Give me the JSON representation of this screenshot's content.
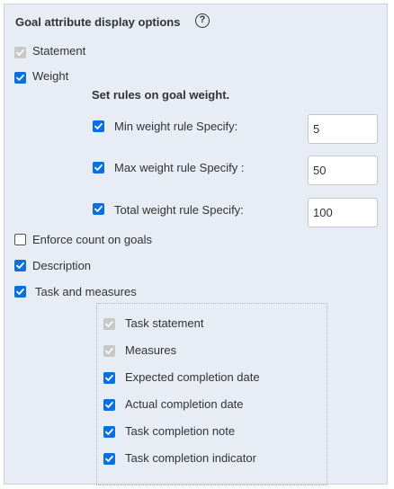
{
  "section": {
    "title": "Goal attribute display options",
    "help_glyph": "?"
  },
  "options": {
    "statement": {
      "label": "Statement",
      "state": "checked-disabled"
    },
    "weight": {
      "label": "Weight",
      "state": "checked"
    },
    "weight_rules": {
      "heading": "Set rules on goal weight.",
      "min": {
        "label": "Min weight rule Specify:",
        "value": "5",
        "state": "checked"
      },
      "max": {
        "label": "Max weight rule Specify :",
        "value": "50",
        "state": "checked"
      },
      "total": {
        "label": "Total weight rule  Specify:",
        "value": "100",
        "state": "checked"
      }
    },
    "enforce_count": {
      "label": "Enforce count on goals",
      "state": "unchecked"
    },
    "description": {
      "label": "Description",
      "state": "checked"
    },
    "task_and_measures": {
      "label": "Task and measures",
      "state": "checked",
      "items": [
        {
          "label": "Task statement",
          "state": "checked-disabled"
        },
        {
          "label": "Measures",
          "state": "checked-disabled"
        },
        {
          "label": "Expected completion date",
          "state": "checked"
        },
        {
          "label": "Actual completion date",
          "state": "checked"
        },
        {
          "label": "Task completion note",
          "state": "checked"
        },
        {
          "label": "Task completion indicator",
          "state": "checked"
        }
      ]
    }
  },
  "colors": {
    "panel_background": "#e7ecf5",
    "checkbox_checked": "#0b6fe0",
    "checkbox_disabled": "#c8c8c8"
  },
  "icons": {
    "help": "help-circle-icon",
    "check": "checkmark-icon"
  }
}
